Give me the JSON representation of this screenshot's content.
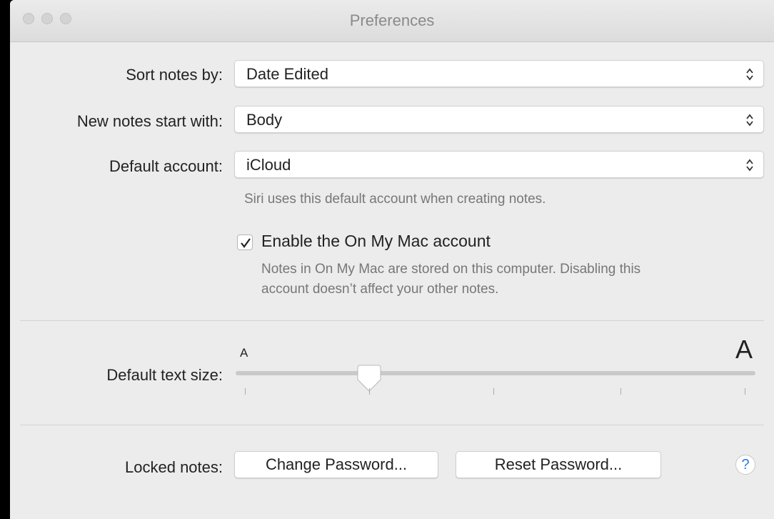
{
  "window": {
    "title": "Preferences"
  },
  "sort_notes": {
    "label": "Sort notes by:",
    "value": "Date Edited"
  },
  "new_notes": {
    "label": "New notes start with:",
    "value": "Body"
  },
  "default_account": {
    "label": "Default account:",
    "value": "iCloud",
    "hint": "Siri uses this default account when creating notes."
  },
  "on_my_mac": {
    "checked": true,
    "label": "Enable the On My Mac account",
    "hint_line1": "Notes in On My Mac are stored on this computer. Disabling this",
    "hint_line2": "account doesn’t affect your other notes."
  },
  "text_size": {
    "label": "Default text size:",
    "small_glyph": "A",
    "large_glyph": "A",
    "level_fraction": 0.25,
    "tick_count": 5
  },
  "locked_notes": {
    "label": "Locked notes:",
    "change_button": "Change Password...",
    "reset_button": "Reset Password...",
    "help": "?"
  },
  "icons": {
    "help": "question-mark-icon",
    "checkbox": "checkmark-icon",
    "popup": "up-down-chevron-icon"
  }
}
